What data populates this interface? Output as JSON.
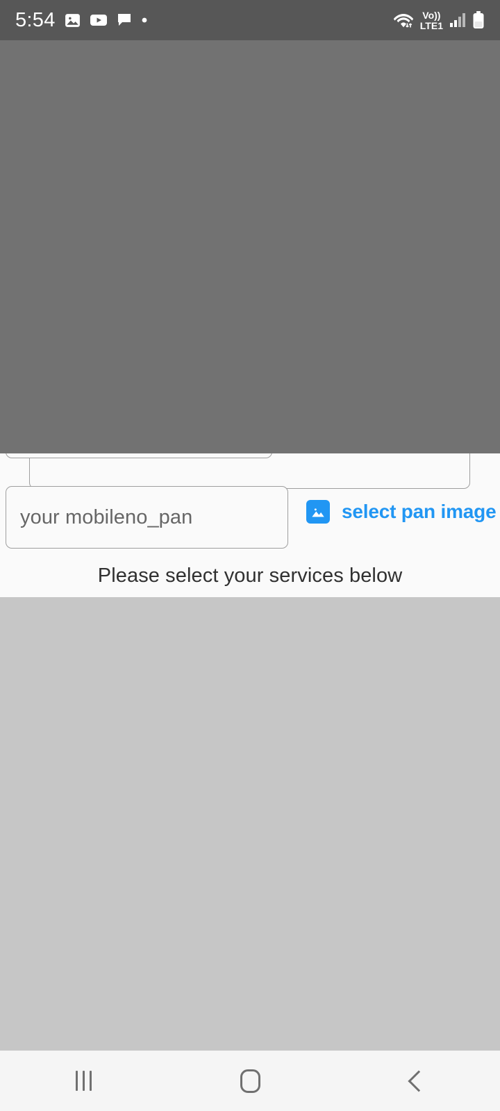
{
  "status_bar": {
    "time": "5:54",
    "left_icons": [
      {
        "name": "photo-icon",
        "glyph": "image"
      },
      {
        "name": "youtube-play-icon",
        "glyph": "play"
      },
      {
        "name": "message-bubble-icon",
        "glyph": "chat"
      },
      {
        "name": "more-notifications-dot-icon",
        "glyph": "dot"
      }
    ],
    "right_icons": [
      {
        "name": "wifi-data-transfer-icon",
        "glyph": "wifi"
      },
      {
        "name": "volte-icon",
        "label_top": "Vo))",
        "label_bottom": "LTE1"
      },
      {
        "name": "cellular-signal-icon",
        "glyph": "bars"
      },
      {
        "name": "battery-icon",
        "glyph": "battery"
      }
    ],
    "background_color": "#575757",
    "foreground_color": "#ffffff"
  },
  "overlay": {
    "name": "dim-scrim",
    "color": "#727272"
  },
  "form": {
    "background_color": "#fafafa",
    "pan_field": {
      "placeholder": "your mobileno_pan",
      "value": ""
    },
    "select_pan_image": {
      "label": "select pan image",
      "color": "#2196f3",
      "icon": "image-picker-icon"
    },
    "services_hint": "Please select your services below",
    "partial_fields": [
      {
        "name": "field-upper-wide",
        "value": ""
      },
      {
        "name": "field-upper-narrow",
        "value": ""
      }
    ]
  },
  "content_area": {
    "background_color": "#c6c6c6"
  },
  "nav_bar": {
    "background_color": "#f5f5f5",
    "buttons": [
      {
        "name": "nav-recents-button",
        "label": "Recents"
      },
      {
        "name": "nav-home-button",
        "label": "Home"
      },
      {
        "name": "nav-back-button",
        "label": "Back"
      }
    ]
  }
}
